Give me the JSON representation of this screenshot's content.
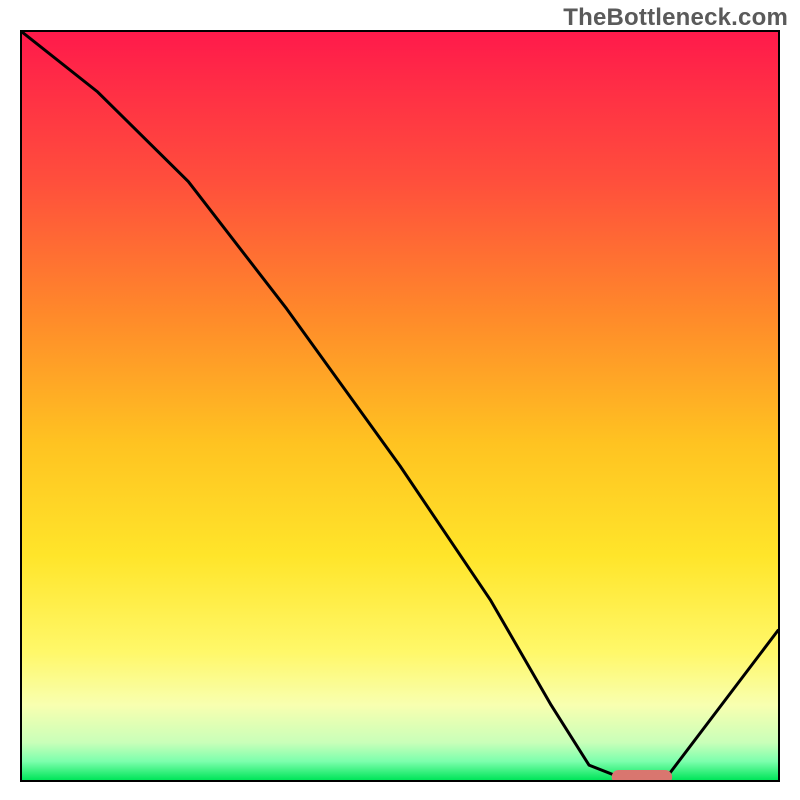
{
  "watermark": "TheBottleneck.com",
  "colors": {
    "border": "#000000",
    "curve": "#000000",
    "marker_fill": "#d9766f",
    "gradient_stops": [
      {
        "offset": 0.0,
        "color": "#ff1a4b"
      },
      {
        "offset": 0.2,
        "color": "#ff4f3c"
      },
      {
        "offset": 0.38,
        "color": "#ff8a2a"
      },
      {
        "offset": 0.55,
        "color": "#ffc321"
      },
      {
        "offset": 0.7,
        "color": "#ffe52a"
      },
      {
        "offset": 0.83,
        "color": "#fff86a"
      },
      {
        "offset": 0.9,
        "color": "#f8ffb0"
      },
      {
        "offset": 0.95,
        "color": "#c9ffb9"
      },
      {
        "offset": 0.975,
        "color": "#7dffad"
      },
      {
        "offset": 1.0,
        "color": "#00e55a"
      }
    ]
  },
  "chart_data": {
    "type": "line",
    "title": "",
    "xlabel": "",
    "ylabel": "",
    "xlim": [
      0,
      100
    ],
    "ylim": [
      0,
      100
    ],
    "legend": null,
    "grid": false,
    "series": [
      {
        "name": "bottleneck-curve",
        "x": [
          0,
          10,
          22,
          35,
          50,
          62,
          70,
          75,
          80,
          85,
          100
        ],
        "y": [
          100,
          92,
          80,
          63,
          42,
          24,
          10,
          2,
          0,
          0,
          20
        ]
      }
    ],
    "marker": {
      "name": "optimal-range",
      "x_start": 78,
      "x_end": 86,
      "y": 0
    },
    "background": "vertical-gradient red→green (top→bottom)"
  }
}
